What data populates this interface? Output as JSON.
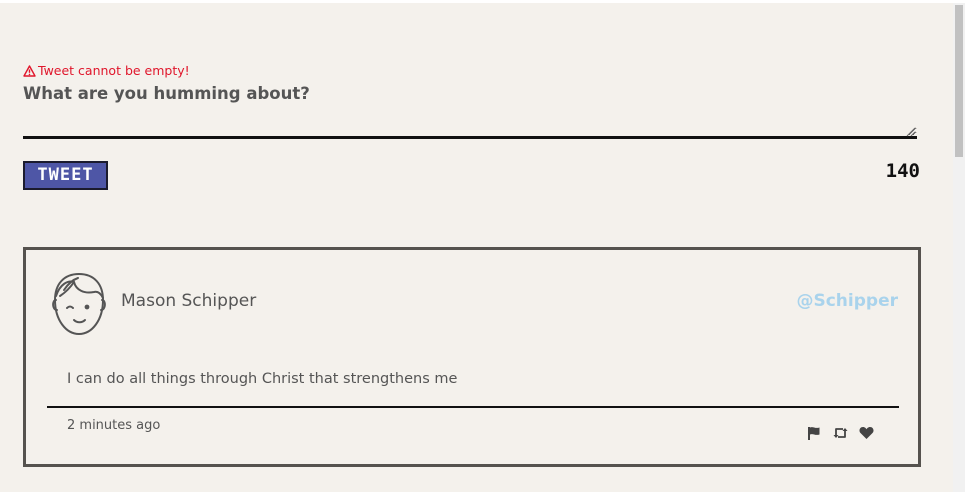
{
  "compose": {
    "error_message": "Tweet cannot be empty!",
    "placeholder": "What are you humming about?",
    "value": "",
    "tweet_button_label": "TWEET",
    "char_count": "140"
  },
  "tweets": [
    {
      "author_name": "Mason Schipper",
      "handle": "@Schipper",
      "text": "I can do all things through Christ that strengthens me",
      "time_ago": "2 minutes ago",
      "actions": [
        "flag-icon",
        "retweet-icon",
        "heart-icon"
      ]
    }
  ],
  "colors": {
    "background": "#f4f1ec",
    "error": "#e0162b",
    "button": "#4e56a6",
    "handle": "#a9d3ec",
    "text": "#555555",
    "border": "#55524e"
  }
}
